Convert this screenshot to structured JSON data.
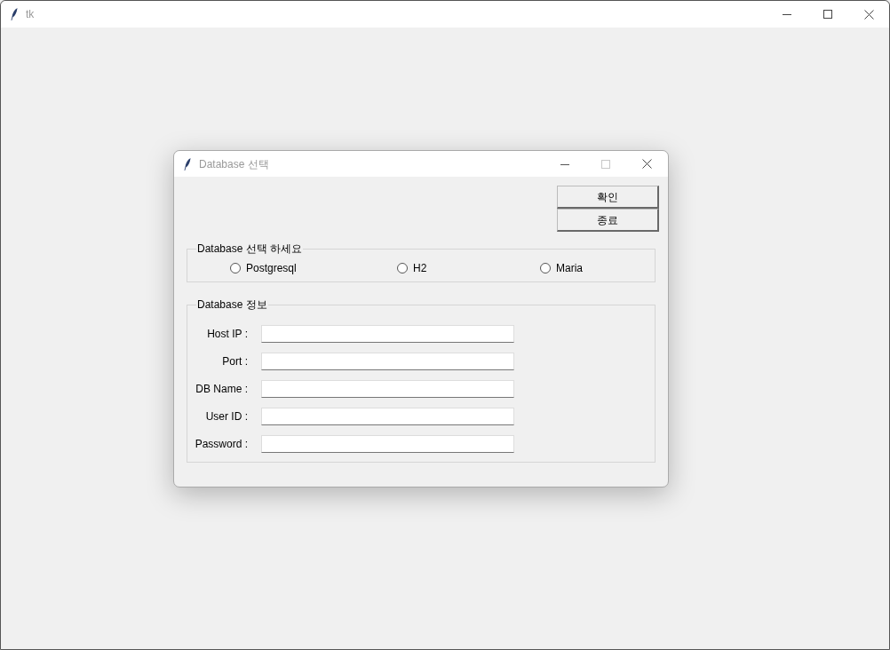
{
  "main_window": {
    "title": "tk"
  },
  "dialog": {
    "title": "Database 선택"
  },
  "buttons": [
    "확인",
    "종료"
  ],
  "db_choice": {
    "legend": "Database 선택 하세요",
    "options": [
      {
        "label": "Postgresql",
        "selected": false
      },
      {
        "label": "H2",
        "selected": false
      },
      {
        "label": "Maria",
        "selected": false
      }
    ]
  },
  "db_info": {
    "legend": "Database 정보",
    "fields": [
      {
        "label": "Host IP :"
      },
      {
        "label": "Port :"
      },
      {
        "label": "DB Name :"
      },
      {
        "label": "User ID :"
      },
      {
        "label": "Password :"
      }
    ]
  }
}
